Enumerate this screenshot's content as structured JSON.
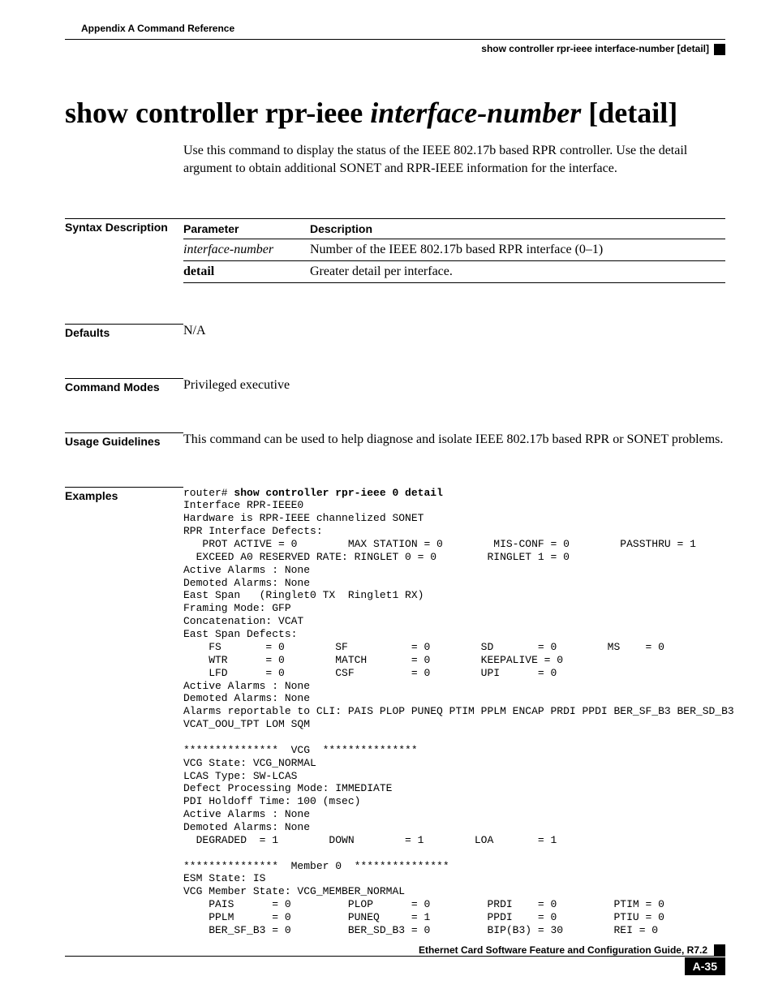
{
  "header": {
    "appendix": "Appendix A      Command Reference",
    "section": "show controller rpr-ieee interface-number  [detail]"
  },
  "title": {
    "prefix": "show controller rpr-ieee ",
    "italic": "interface-number",
    "suffix": "  [detail]"
  },
  "intro": "Use this command to display the status of the IEEE 802.17b based RPR controller. Use the detail argument to obtain additional SONET and RPR-IEEE information for the interface.",
  "labels": {
    "syntax": "Syntax Description",
    "defaults": "Defaults",
    "modes": "Command Modes",
    "usage": "Usage Guidelines",
    "examples": "Examples"
  },
  "param_table": {
    "headers": {
      "param": "Parameter",
      "desc": "Description"
    },
    "rows": [
      {
        "param": "interface-number",
        "param_style": "ital",
        "desc": "Number of the IEEE 802.17b based RPR interface (0–1)"
      },
      {
        "param": "detail",
        "param_style": "bold",
        "desc": "Greater detail per interface."
      }
    ]
  },
  "defaults": "N/A",
  "modes": "Privileged executive",
  "usage": "This command can be used to help diagnose and isolate IEEE 802.17b based RPR or SONET problems.",
  "example": {
    "prompt": "router# ",
    "cmd": "show controller rpr-ieee 0 detail",
    "body": "Interface RPR-IEEE0\nHardware is RPR-IEEE channelized SONET\nRPR Interface Defects:\n   PROT ACTIVE = 0        MAX STATION = 0        MIS-CONF = 0        PASSTHRU = 1\n  EXCEED A0 RESERVED RATE: RINGLET 0 = 0        RINGLET 1 = 0\nActive Alarms : None\nDemoted Alarms: None\nEast Span   (Ringlet0 TX  Ringlet1 RX)\nFraming Mode: GFP\nConcatenation: VCAT\nEast Span Defects:\n    FS       = 0        SF          = 0        SD       = 0        MS    = 0     \n    WTR      = 0        MATCH       = 0        KEEPALIVE = 0\n    LFD      = 0        CSF         = 0        UPI      = 0\nActive Alarms : None\nDemoted Alarms: None\nAlarms reportable to CLI: PAIS PLOP PUNEQ PTIM PPLM ENCAP PRDI PPDI BER_SF_B3 BER_SD_B3 \nVCAT_OOU_TPT LOM SQM \n\n***************  VCG  ***************\nVCG State: VCG_NORMAL\nLCAS Type: SW-LCAS\nDefect Processing Mode: IMMEDIATE\nPDI Holdoff Time: 100 (msec)\nActive Alarms : None\nDemoted Alarms: None\n  DEGRADED  = 1        DOWN        = 1        LOA       = 1\n\n***************  Member 0  ***************\nESM State: IS\nVCG Member State: VCG_MEMBER_NORMAL\n    PAIS      = 0         PLOP      = 0         PRDI    = 0         PTIM = 0\n    PPLM      = 0         PUNEQ     = 1         PPDI    = 0         PTIU = 0\n    BER_SF_B3 = 0         BER_SD_B3 = 0         BIP(B3) = 30        REI = 0"
  },
  "footer": {
    "guide": "Ethernet Card Software Feature and Configuration Guide, R7.2",
    "page": "A-35"
  }
}
